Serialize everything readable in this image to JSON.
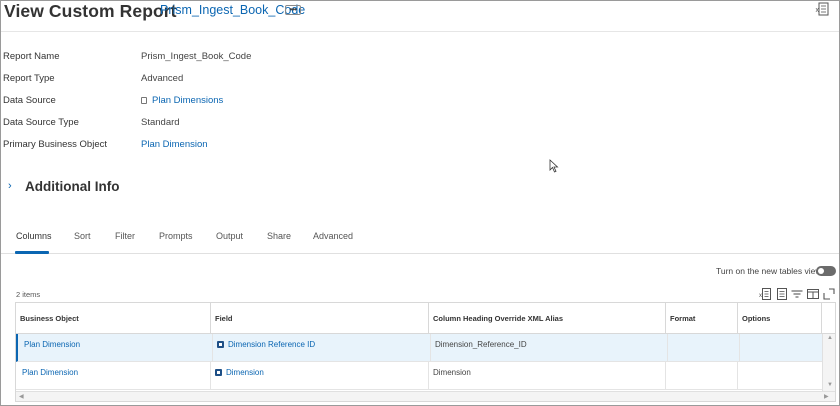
{
  "header": {
    "title": "View Custom Report",
    "report_link": "Prism_Ingest_Book_Code",
    "more_label": "•••"
  },
  "details": {
    "fields": [
      {
        "label": "Report Name",
        "value": "Prism_Ingest_Book_Code"
      },
      {
        "label": "Report Type",
        "value": "Advanced"
      },
      {
        "label": "Data Source",
        "value": "Plan Dimensions"
      },
      {
        "label": "Data Source Type",
        "value": "Standard"
      },
      {
        "label": "Primary Business Object",
        "value": "Plan Dimension"
      }
    ]
  },
  "additional_info": {
    "chevron": "›",
    "title": "Additional Info"
  },
  "tabs": [
    {
      "label": "Columns",
      "active": true
    },
    {
      "label": "Sort"
    },
    {
      "label": "Filter"
    },
    {
      "label": "Prompts"
    },
    {
      "label": "Output"
    },
    {
      "label": "Share"
    },
    {
      "label": "Advanced"
    }
  ],
  "table_toolbar": {
    "toggle_label": "Turn on the new tables view",
    "items_count": "2 items"
  },
  "table": {
    "headers": [
      "Business Object",
      "Field",
      "Column Heading Override XML Alias",
      "Format",
      "Options"
    ],
    "rows": [
      {
        "business_object": "Plan Dimension",
        "field": "Dimension Reference ID",
        "alias": "Dimension_Reference_ID",
        "format": "",
        "options": ""
      },
      {
        "business_object": "Plan Dimension",
        "field": "Dimension",
        "alias": "Dimension",
        "format": "",
        "options": ""
      }
    ]
  },
  "colors": {
    "link": "#0b66b2",
    "selected_row": "#e8f3fb",
    "toggle_off": "#6b6b6b"
  }
}
